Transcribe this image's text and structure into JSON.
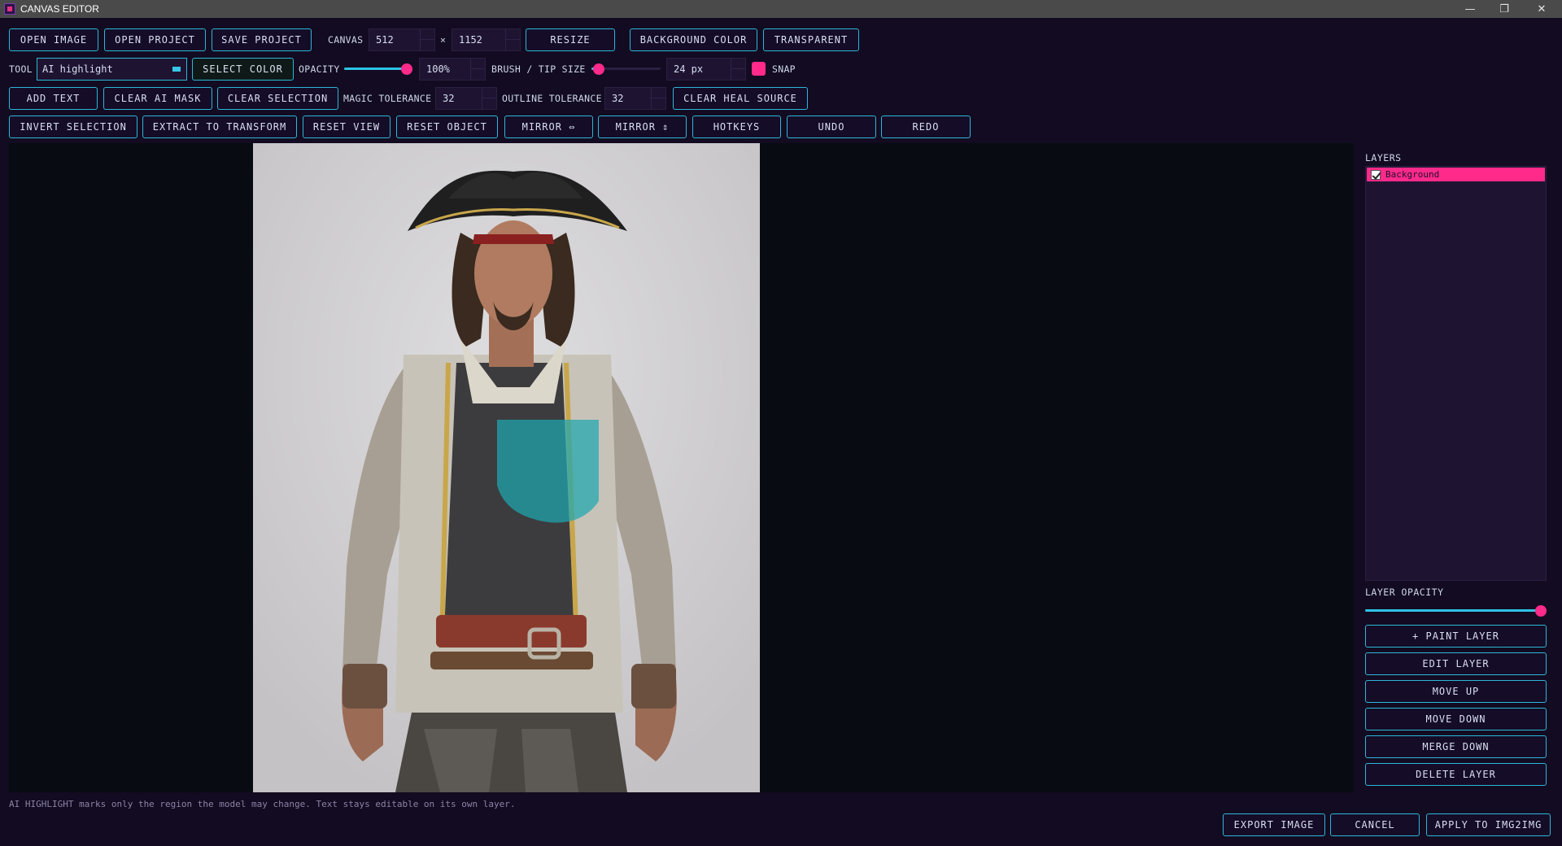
{
  "window": {
    "title": "CANVAS EDITOR",
    "minimize_glyph": "—",
    "restore_glyph": "❐",
    "close_glyph": "✕"
  },
  "toolbar1": {
    "open_image": "OPEN IMAGE",
    "open_project": "OPEN PROJECT",
    "save_project": "SAVE PROJECT",
    "canvas_label": "CANVAS",
    "canvas_width": "512",
    "times": "×",
    "canvas_height": "1152",
    "resize": "RESIZE",
    "background_color": "BACKGROUND COLOR",
    "transparent": "TRANSPARENT"
  },
  "toolbar2": {
    "tool_label": "TOOL",
    "tool_value": "AI highlight",
    "select_color": "SELECT COLOR",
    "opacity_label": "OPACITY",
    "opacity_level": 1.0,
    "opacity_value": "100%",
    "brush_label": "BRUSH / TIP SIZE",
    "brush_level": 0.1,
    "brush_value": "24 px",
    "snap_label": "SNAP",
    "snap_color": "#ff2a8a"
  },
  "toolbar3": {
    "add_text": "ADD TEXT",
    "clear_ai_mask": "CLEAR AI MASK",
    "clear_selection": "CLEAR SELECTION",
    "magic_tolerance_label": "MAGIC TOLERANCE",
    "magic_tolerance_value": "32",
    "outline_tolerance_label": "OUTLINE TOLERANCE",
    "outline_tolerance_value": "32",
    "clear_heal_source": "CLEAR HEAL SOURCE"
  },
  "toolbar4": {
    "invert_selection": "INVERT SELECTION",
    "extract_to_transform": "EXTRACT TO TRANSFORM",
    "reset_view": "RESET VIEW",
    "reset_object": "RESET OBJECT",
    "mirror_h": "MIRROR ⇔",
    "mirror_v": "MIRROR ⇕",
    "hotkeys": "HOTKEYS",
    "undo": "UNDO",
    "redo": "REDO"
  },
  "layers": {
    "title": "LAYERS",
    "items": [
      {
        "name": "Background",
        "visible": true,
        "selected": true
      }
    ],
    "opacity_label": "LAYER OPACITY",
    "opacity_level": 1.0,
    "add_paint_layer": "+ PAINT LAYER",
    "edit_layer": "EDIT LAYER",
    "move_up": "MOVE UP",
    "move_down": "MOVE DOWN",
    "merge_down": "MERGE DOWN",
    "delete_layer": "DELETE LAYER"
  },
  "hint": "AI HIGHLIGHT marks only the region the model may change. Text stays editable on its own layer.",
  "footer": {
    "export_image": "EXPORT IMAGE",
    "cancel": "CANCEL",
    "apply": "APPLY TO IMG2IMG"
  },
  "colors": {
    "accent": "#2db7d6",
    "highlight": "#ff2a8a",
    "ai_mask": "#1ea8b0"
  }
}
